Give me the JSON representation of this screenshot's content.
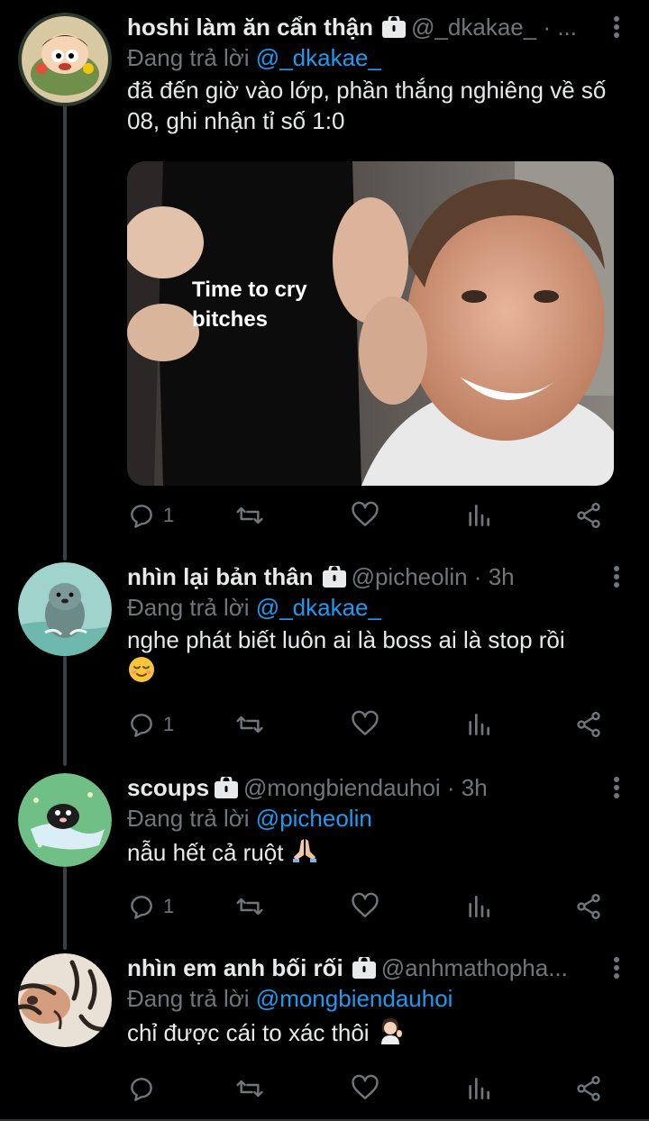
{
  "reply_prefix": "Đang trả lời",
  "tweets": [
    {
      "name": "hoshi làm ăn cẩn thận",
      "handle": "@_dkakae_ · ...",
      "reply_to": "@_dkakae_",
      "text": "đã đến giờ vào lớp, phần thắng nghiêng về số 08, ghi nhận tỉ số 1:0",
      "media_text": [
        "Time to cry",
        "bitches"
      ],
      "reply_count": "1"
    },
    {
      "name": "nhìn lại bản thân",
      "handle": "@picheolin · 3h",
      "reply_to": "@_dkakae_",
      "text": "nghe phát biết luôn ai là boss ai là stop rồi",
      "reply_count": "1"
    },
    {
      "name": "scoups",
      "handle": "@mongbiendauhoi · 3h",
      "reply_to": "@picheolin",
      "text": "nẫu hết cả ruột",
      "reply_count": "1"
    },
    {
      "name": "nhìn em anh bối rối",
      "handle": "@anhmathopha...",
      "reply_to": "@mongbiendauhoi",
      "text": "chỉ được cái to xác thôi",
      "reply_count": ""
    }
  ],
  "icons": {
    "reply": "reply-icon",
    "retweet": "retweet-icon",
    "like": "heart-icon",
    "views": "analytics-icon",
    "share": "share-icon",
    "more": "more-vertical-icon",
    "lock": "lock-icon"
  },
  "colors": {
    "background": "#000000",
    "text": "#e7e9ea",
    "secondary": "#71767b",
    "link": "#1d9bf0",
    "thread_line": "#3a3f44"
  }
}
